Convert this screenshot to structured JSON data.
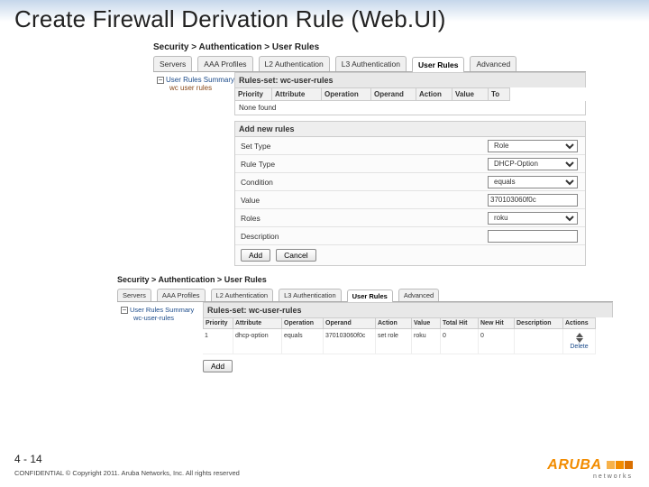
{
  "title": "Create Firewall Derivation Rule (Web.UI)",
  "breadcrumb": "Security > Authentication > User Rules",
  "tabs": [
    "Servers",
    "AAA Profiles",
    "L2 Authentication",
    "L3 Authentication",
    "User Rules",
    "Advanced"
  ],
  "activeTab": "User Rules",
  "tree": {
    "root": "User Rules Summary",
    "child": "wc user rules"
  },
  "rulesSet": {
    "header": "Rules-set: wc-user-rules",
    "cols": [
      "Priority",
      "Attribute",
      "Operation",
      "Operand",
      "Action",
      "Value",
      "To"
    ],
    "none": "None found"
  },
  "addSection": "Add new rules",
  "form": {
    "setType": {
      "label": "Set Type",
      "value": "Role"
    },
    "ruleType": {
      "label": "Rule Type",
      "value": "DHCP-Option"
    },
    "condition": {
      "label": "Condition",
      "value": "equals"
    },
    "value": {
      "label": "Value",
      "value": "370103060f0c"
    },
    "roles": {
      "label": "Roles",
      "value": "roku"
    },
    "description": {
      "label": "Description",
      "value": ""
    }
  },
  "buttons": {
    "add": "Add",
    "cancel": "Cancel"
  },
  "panel2": {
    "breadcrumb": "Security > Authentication > User Rules",
    "tree": {
      "root": "User Rules Summary",
      "child": "wc-user-rules"
    },
    "rulesSetHeader": "Rules-set: wc-user-rules",
    "cols": [
      "Priority",
      "Attribute",
      "Operation",
      "Operand",
      "Action",
      "Value",
      "Total Hit",
      "New Hit",
      "Description",
      "Actions"
    ],
    "row": {
      "priority": "1",
      "attribute": "dhcp-option",
      "operation": "equals",
      "operand": "370103060f0c",
      "action": "set role",
      "value": "roku",
      "totalHit": "0",
      "newHit": "0",
      "description": ""
    },
    "delete": "Delete",
    "addBtn": "Add"
  },
  "footer": {
    "page": "4 - 14",
    "conf": "CONFIDENTIAL © Copyright 2011. Aruba Networks, Inc. All rights reserved",
    "brand": "ARUBA",
    "sub": "networks"
  }
}
